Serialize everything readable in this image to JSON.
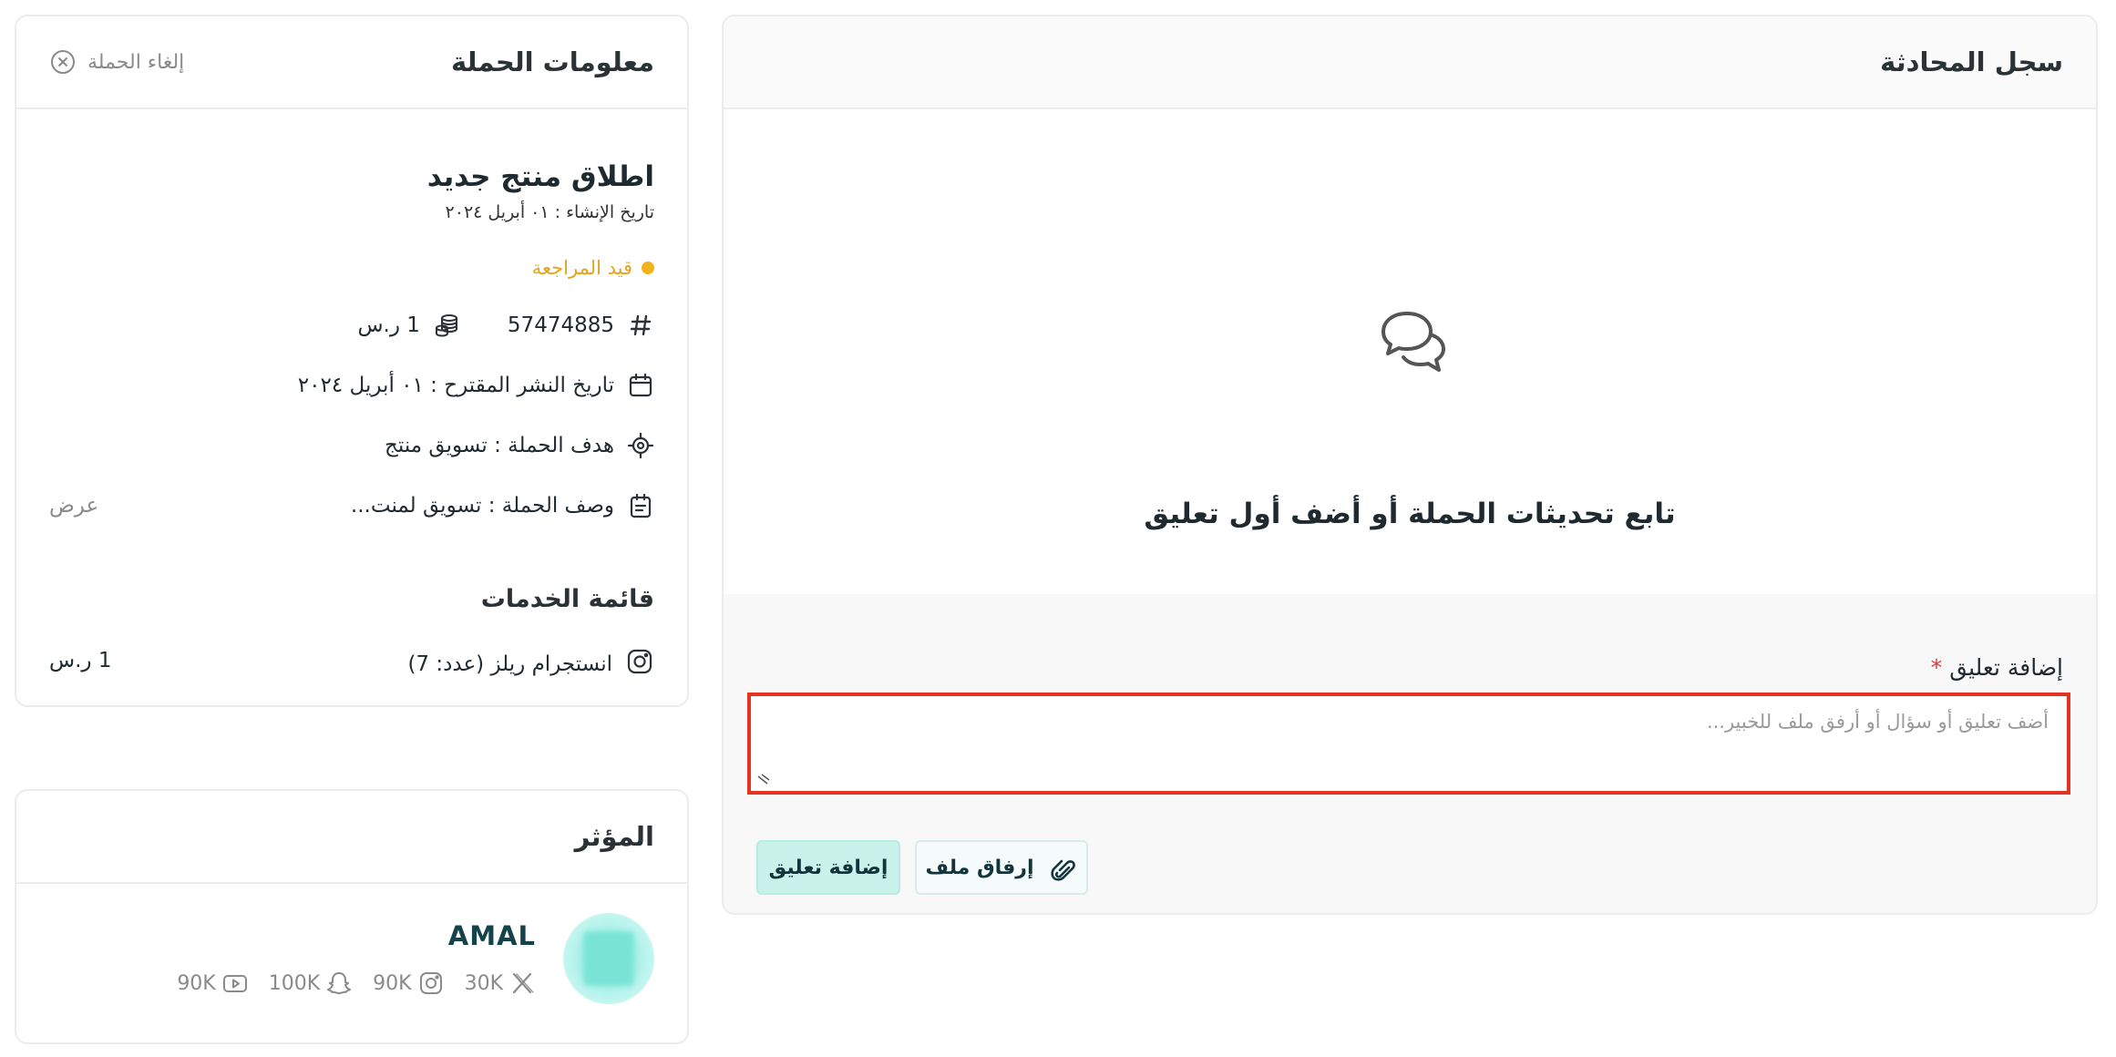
{
  "chat": {
    "title": "سجل المحادثة",
    "empty_text": "تابع تحديثات الحملة أو أضف أول تعليق",
    "comment_label": "إضافة تعليق",
    "required_mark": "*",
    "comment_placeholder": "أضف تعليق أو سؤال أو أرفق ملف للخبير...",
    "attach_label": "إرفاق ملف",
    "add_label": "إضافة تعليق"
  },
  "campaign": {
    "title": "معلومات الحملة",
    "cancel_label": "إلغاء الحملة",
    "name": "اطلاق منتج جديد",
    "created": "تاريخ الإنشاء : ٠١ أبريل ٢٠٢٤",
    "status": "قيد المراجعة",
    "id": "57474885",
    "budget": "1 ر.س",
    "publish_date": "تاريخ النشر المقترح : ٠١ أبريل ٢٠٢٤",
    "goal": "هدف الحملة : تسويق منتج",
    "description": "وصف الحملة : تسويق لمنت...",
    "view_label": "عرض",
    "services_title": "قائمة الخدمات",
    "services": [
      {
        "name": "انستجرام ريلز (عدد: 7)",
        "price": "1 ر.س",
        "icon": "instagram-icon"
      }
    ],
    "colors": {
      "status": "#e7a31c",
      "accent": "#c9f3ea",
      "error": "#e53322"
    }
  },
  "influencer": {
    "title": "المؤثر",
    "name": "AMAL",
    "socials": [
      {
        "platform": "x",
        "count": "30K",
        "icon": "x-icon"
      },
      {
        "platform": "instagram",
        "count": "90K",
        "icon": "instagram-icon"
      },
      {
        "platform": "snapchat",
        "count": "100K",
        "icon": "snapchat-icon"
      },
      {
        "platform": "youtube",
        "count": "90K",
        "icon": "youtube-icon"
      }
    ]
  }
}
